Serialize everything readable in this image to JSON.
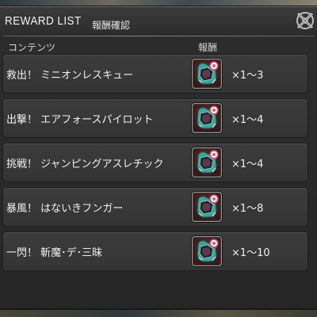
{
  "window": {
    "title": "REWARD LIST",
    "subtitle": "報酬確認"
  },
  "columns": {
    "content": "コンテンツ",
    "reward": "報酬"
  },
  "rows": [
    {
      "name": "救出！ ミニオンレスキュー",
      "reward_icon": "minion-token-icon",
      "qty": "×1～3"
    },
    {
      "name": "出撃！ エアフォースパイロット",
      "reward_icon": "minion-token-icon",
      "qty": "×1～4"
    },
    {
      "name": "挑戦！ ジャンピングアスレチック",
      "reward_icon": "minion-token-icon",
      "qty": "×1～4"
    },
    {
      "name": "暴風！ はないきフンガー",
      "reward_icon": "minion-token-icon",
      "qty": "×1～8"
    },
    {
      "name": "一閃！ 斬魔･デ･三昧",
      "reward_icon": "minion-token-icon",
      "qty": "×1～10"
    }
  ]
}
